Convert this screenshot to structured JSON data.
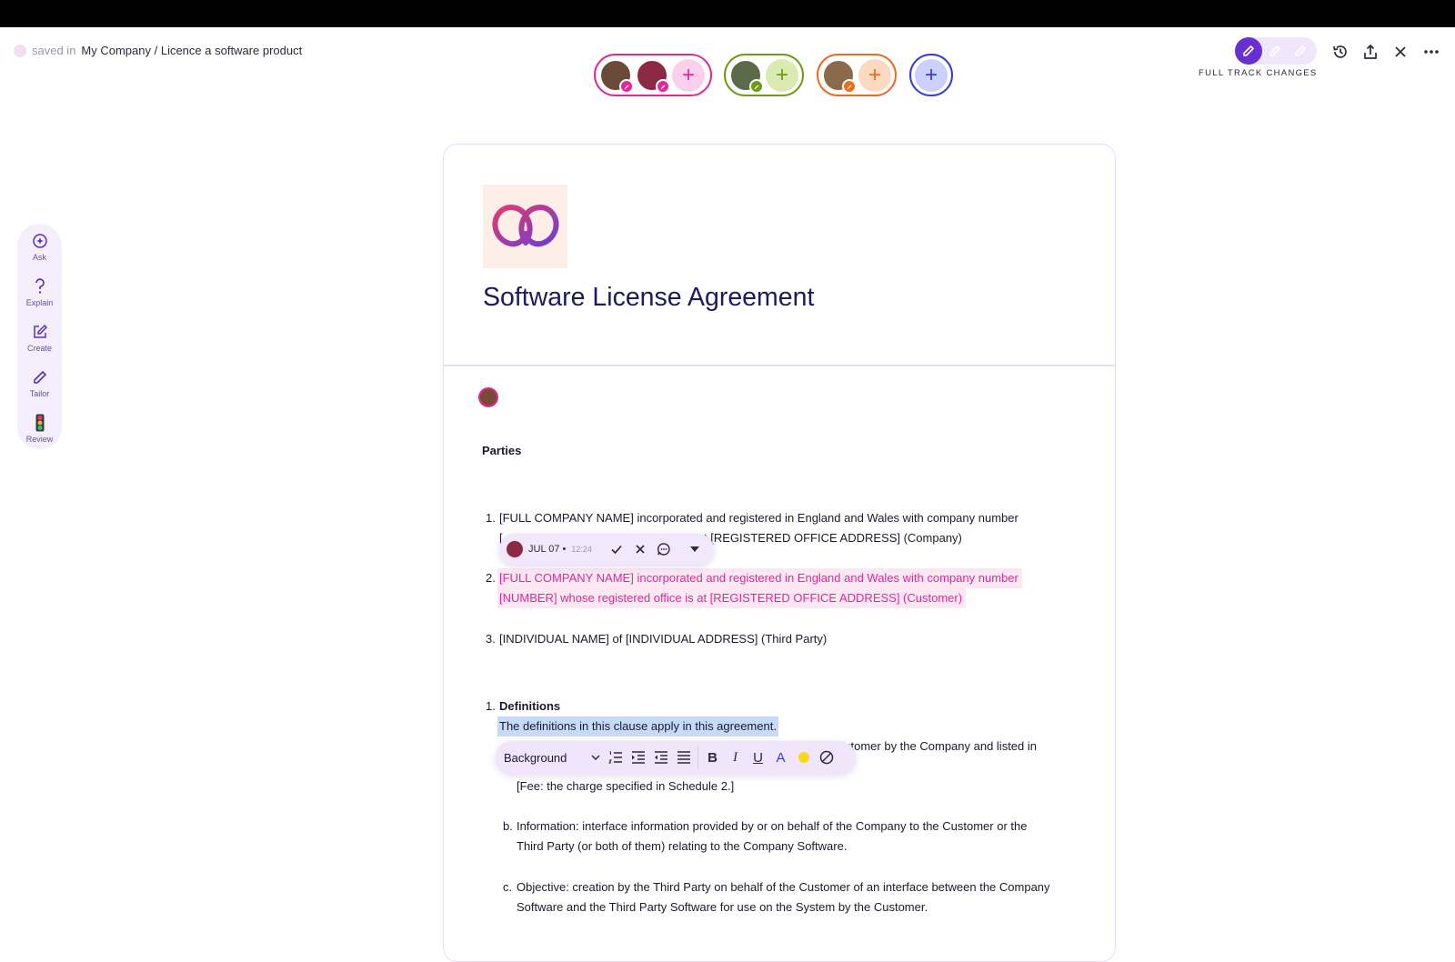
{
  "header": {
    "saved_label": "saved in",
    "breadcrumb": "My Company / Licence a software product",
    "track_changes_label": "FULL TRACK CHANGES"
  },
  "collaborator_groups": [
    {
      "color": "#e0289a",
      "fill": "#fbd0ee",
      "plus": "+"
    },
    {
      "color": "#6e9a14",
      "fill": "#dbeab0",
      "plus": "+"
    },
    {
      "color": "#ee6a1e",
      "fill": "#fcd9c0",
      "plus": "+"
    },
    {
      "color": "#2f3de0",
      "fill": "#cdd0fb",
      "plus": "+"
    }
  ],
  "ai_rail": {
    "items": [
      {
        "label": "Ask",
        "icon": "ask-sparkle-icon"
      },
      {
        "label": "Explain",
        "icon": "question-icon"
      },
      {
        "label": "Create",
        "icon": "edit-square-icon"
      },
      {
        "label": "Tailor",
        "icon": "pencil-icon"
      },
      {
        "label": "Review",
        "icon": "traffic-light-icon"
      }
    ]
  },
  "document": {
    "title": "Software License Agreement",
    "parties_heading": "Parties",
    "parties": [
      {
        "num": "1.",
        "line1": "[FULL COMPANY NAME] incorporated and registered in England and Wales with company number",
        "line2_start": "[",
        "line2_end": "t [REGISTERED OFFICE ADDRESS] (Company)"
      },
      {
        "num": "2.",
        "line1": "[FULL COMPANY NAME] incorporated and registered in England and Wales with company number",
        "line2": "[NUMBER] whose registered office is at [REGISTERED OFFICE ADDRESS] (Customer)"
      },
      {
        "num": "3.",
        "line1": "[INDIVIDUAL NAME] of [INDIVIDUAL ADDRESS] (Third Party)"
      }
    ],
    "definitions": {
      "num": "1.",
      "heading": "Definitions",
      "intro": "The definitions in this clause apply in this agreement.",
      "hidden_line_end": "stomer by the Company and listed in",
      "fee": "[Fee: the charge specified in Schedule 2.]",
      "items": [
        {
          "letter": "b.",
          "line1": "Information: interface information provided by or on behalf of the Company to the Customer or the",
          "line2": "Third Party (or both of them) relating to the Company Software."
        },
        {
          "letter": "c.",
          "line1": "Objective: creation by the Third Party on behalf of the Customer of an interface between the Company",
          "line2": "Software and the Third Party Software for use on the System by the Customer."
        }
      ]
    }
  },
  "change_popover": {
    "date": "JUL 07 •",
    "time": "12:24"
  },
  "format_toolbar": {
    "style_select": "Background",
    "bold": "B",
    "italic": "I",
    "underline": "U",
    "text_color": "A"
  },
  "colors": {
    "accent": "#6a2fd1",
    "insertion": "#e0289a",
    "selection": "#c6dafb",
    "title": "#1d1a5e"
  }
}
